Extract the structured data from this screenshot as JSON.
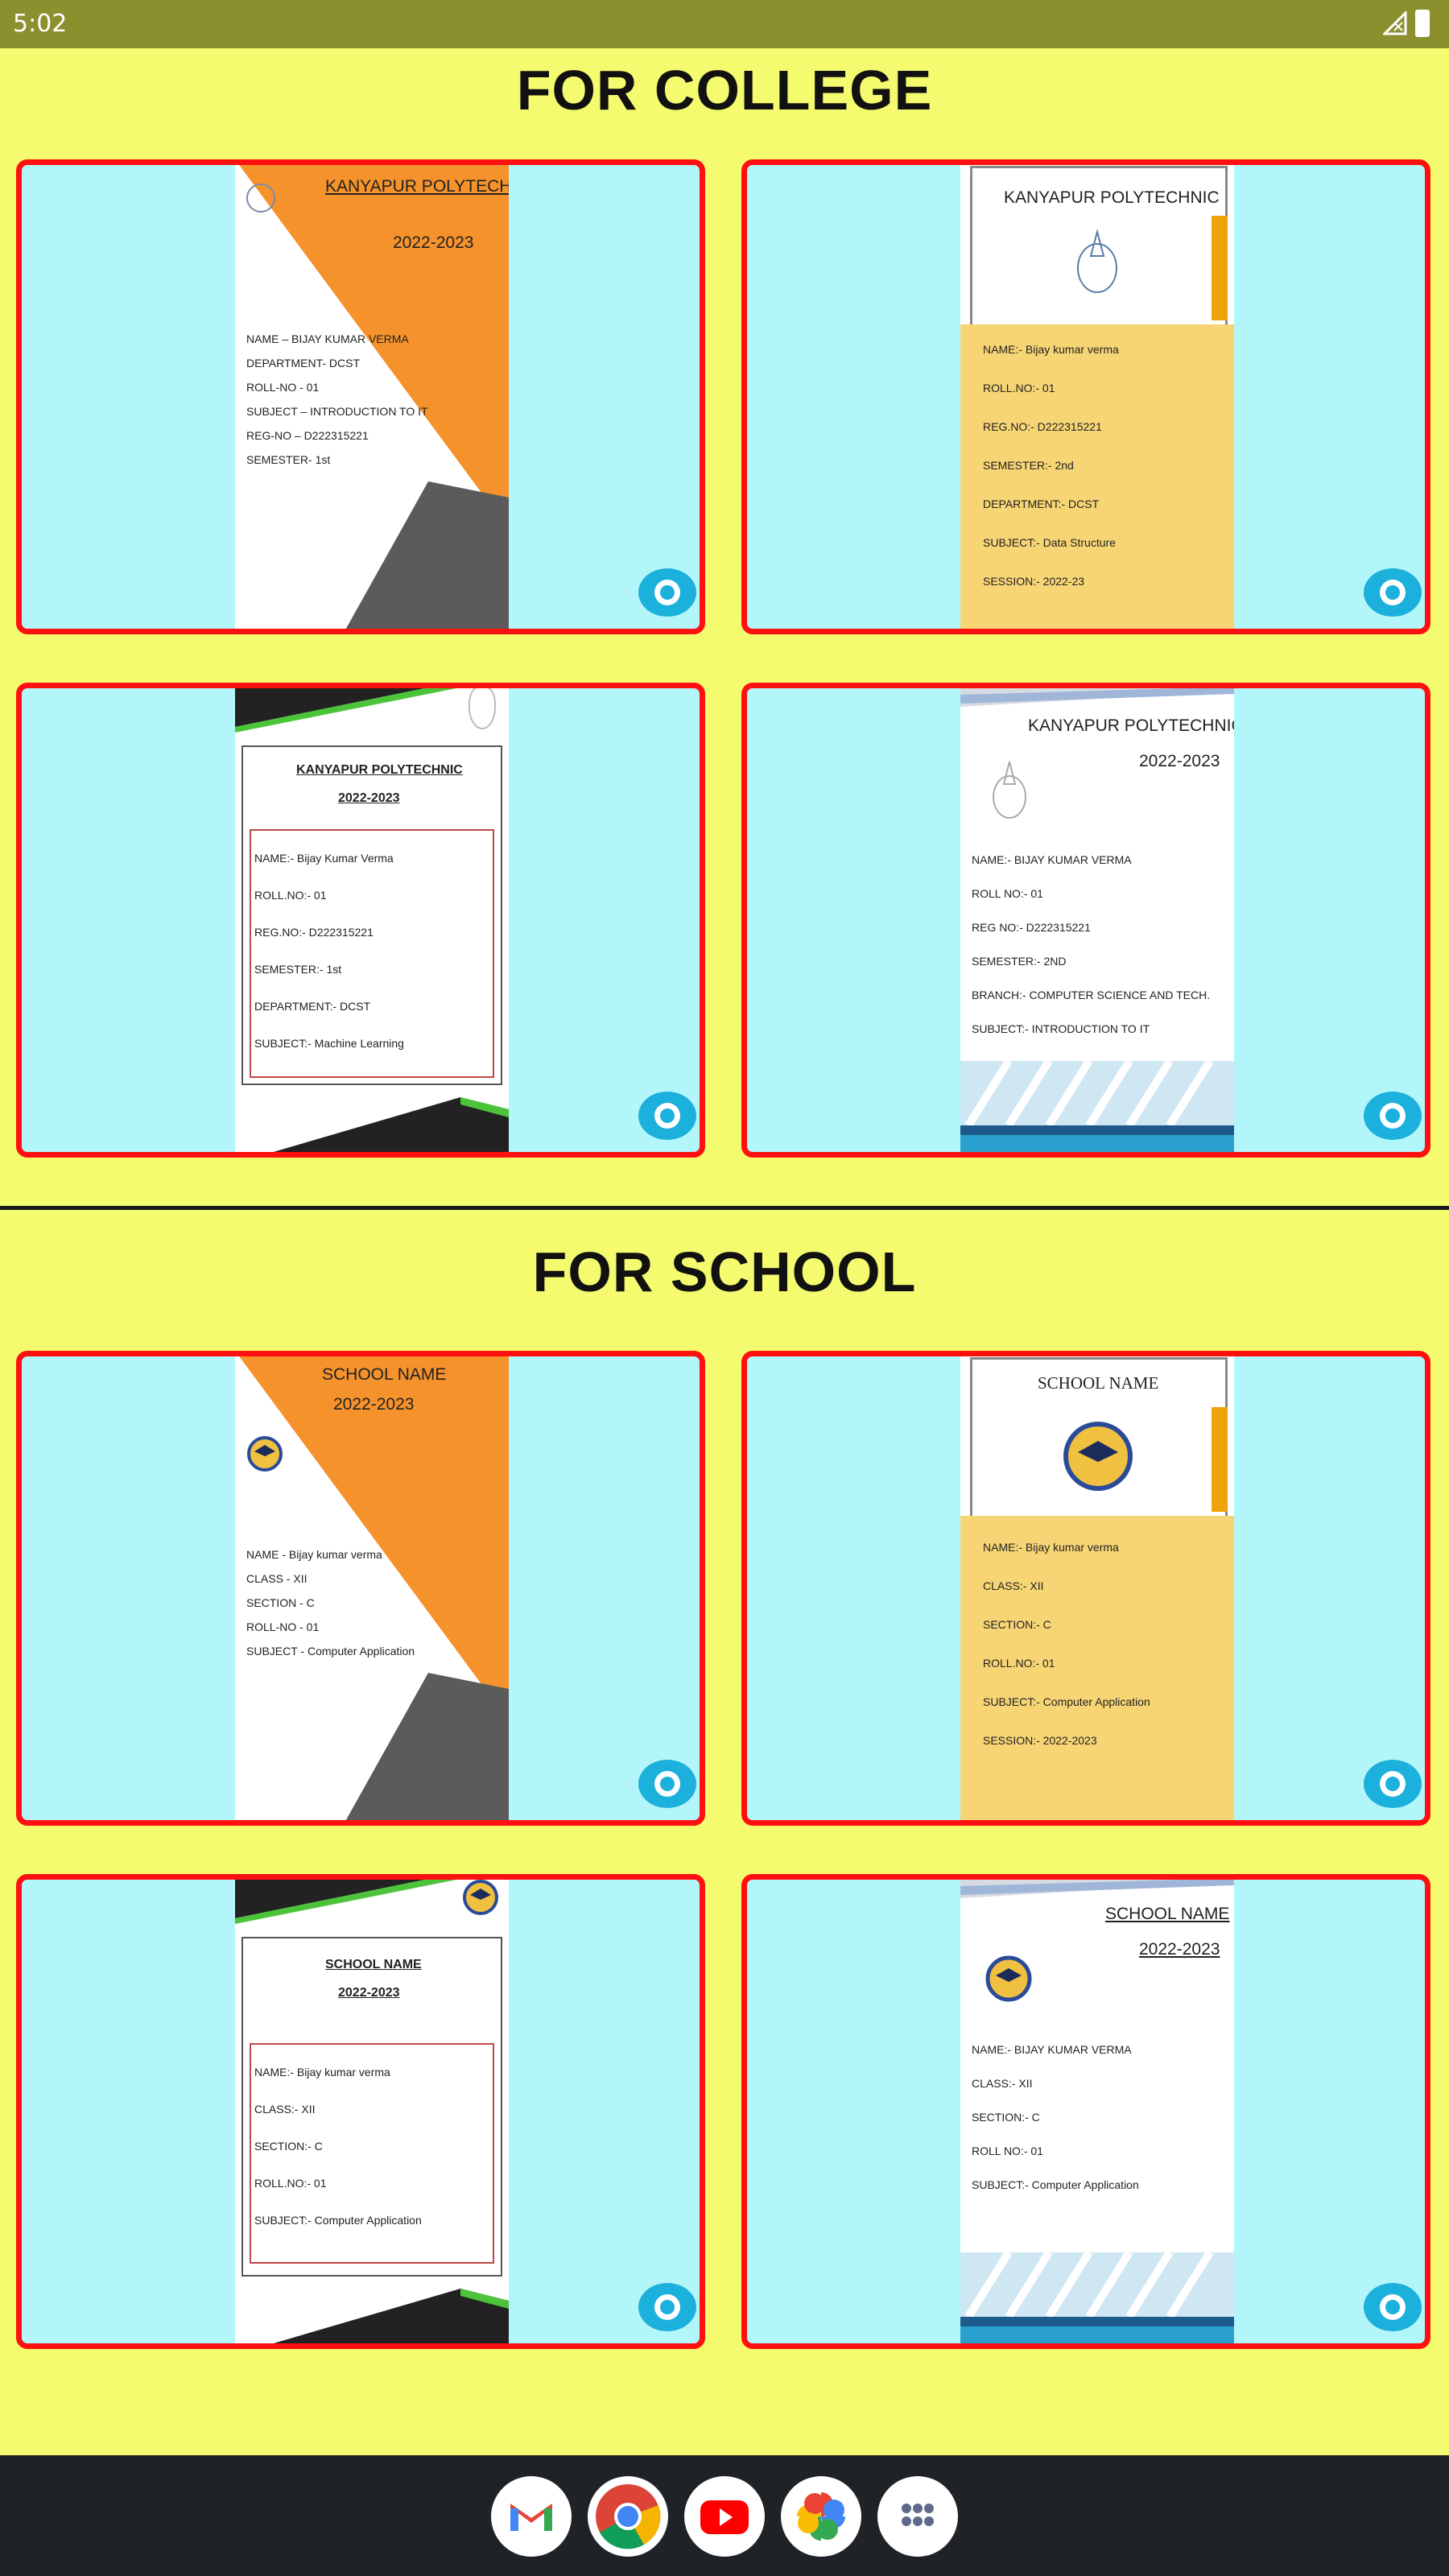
{
  "status_bar": {
    "time": "5:02"
  },
  "sections": {
    "college": {
      "title": "FOR COLLEGE"
    },
    "school": {
      "title": "FOR SCHOOL"
    }
  },
  "templates": {
    "c1": {
      "header": "KANYAPUR POLYTECHNIC",
      "session": "2022-2023",
      "lines": [
        "NAME – BIJAY KUMAR VERMA",
        "DEPARTMENT- DCST",
        "ROLL-NO - 01",
        "SUBJECT – INTRODUCTION TO IT",
        "REG-NO – D222315221",
        "SEMESTER- 1st"
      ]
    },
    "c2": {
      "header": "KANYAPUR POLYTECHNIC",
      "lines": [
        "NAME:- Bijay kumar verma",
        "ROLL.NO:- 01",
        "REG.NO:- D222315221",
        "SEMESTER:- 2nd",
        "DEPARTMENT:- DCST",
        "SUBJECT:- Data Structure",
        "SESSION:- 2022-23"
      ]
    },
    "c3": {
      "header": "KANYAPUR POLYTECHNIC",
      "session": "2022-2023",
      "lines": [
        "NAME:- Bijay Kumar Verma",
        "ROLL.NO:- 01",
        "REG.NO:- D222315221",
        "SEMESTER:- 1st",
        "DEPARTMENT:- DCST",
        "SUBJECT:- Machine Learning"
      ]
    },
    "c4": {
      "header": "KANYAPUR POLYTECHNIC",
      "session": "2022-2023",
      "lines": [
        "NAME:- BIJAY KUMAR VERMA",
        "ROLL NO:- 01",
        "REG NO:- D222315221",
        "SEMESTER:- 2ND",
        "BRANCH:- COMPUTER SCIENCE AND TECH.",
        "SUBJECT:- INTRODUCTION TO IT"
      ]
    },
    "s1": {
      "header": "SCHOOL NAME",
      "session": "2022-2023",
      "lines": [
        "NAME - Bijay kumar verma",
        "CLASS - XII",
        "SECTION - C",
        "ROLL-NO - 01",
        "SUBJECT - Computer Application"
      ]
    },
    "s2": {
      "header": "SCHOOL NAME",
      "lines": [
        "NAME:- Bijay kumar verma",
        "CLASS:- XII",
        "SECTION:- C",
        "ROLL.NO:- 01",
        "SUBJECT:- Computer Application",
        "SESSION:- 2022-2023"
      ]
    },
    "s3": {
      "header": "SCHOOL NAME",
      "session": "2022-2023",
      "lines": [
        "NAME:- Bijay kumar verma",
        "CLASS:- XII",
        "SECTION:- C",
        "ROLL.NO:- 01",
        "SUBJECT:- Computer Application"
      ]
    },
    "s4": {
      "header": "SCHOOL NAME",
      "session": "2022-2023",
      "lines": [
        "NAME:- BIJAY KUMAR VERMA",
        "CLASS:- XII",
        "SECTION:- C",
        "ROLL NO:- 01",
        "SUBJECT:- Computer Application"
      ]
    }
  },
  "dock": {
    "apps": [
      {
        "icon": "gmail-icon"
      },
      {
        "icon": "chrome-icon"
      },
      {
        "icon": "youtube-icon"
      },
      {
        "icon": "photos-icon"
      },
      {
        "icon": "app-drawer-icon"
      }
    ]
  },
  "colors": {
    "background": "#f5fb6e",
    "card_border": "#ff1010",
    "card_fill": "#b3f6fa",
    "eye_button": "#1cb0dc",
    "status_bar": "#8b8f2e"
  }
}
